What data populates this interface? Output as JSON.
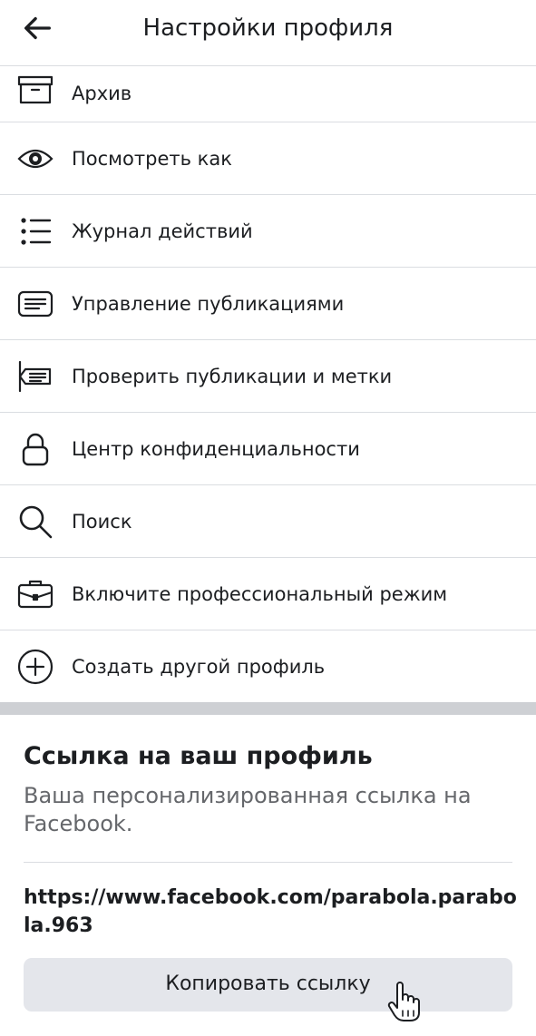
{
  "header": {
    "title": "Настройки профиля",
    "back_icon": "arrow-left-icon"
  },
  "menu": [
    {
      "label": "Архив",
      "icon": "archive-icon"
    },
    {
      "label": "Посмотреть как",
      "icon": "eye-icon"
    },
    {
      "label": "Журнал действий",
      "icon": "list-icon"
    },
    {
      "label": "Управление публикациями",
      "icon": "posts-icon"
    },
    {
      "label": "Проверить публикации и метки",
      "icon": "review-posts-icon"
    },
    {
      "label": "Центр конфиденциальности",
      "icon": "lock-icon"
    },
    {
      "label": "Поиск",
      "icon": "search-icon"
    },
    {
      "label": "Включите профессиональный режим",
      "icon": "briefcase-icon"
    },
    {
      "label": "Создать другой профиль",
      "icon": "plus-circle-icon"
    }
  ],
  "profile_link": {
    "title": "Ссылка на ваш профиль",
    "subtitle": "Ваша персонализированная ссылка на Facebook.",
    "url": "https://www.facebook.com/parabola.parabola.963",
    "copy_label": "Копировать ссылку"
  },
  "colors": {
    "text": "#1c1e21",
    "secondary_text": "#65676b",
    "button_bg": "#e4e6eb",
    "divider": "#dadde1",
    "band": "#ced0d4"
  }
}
